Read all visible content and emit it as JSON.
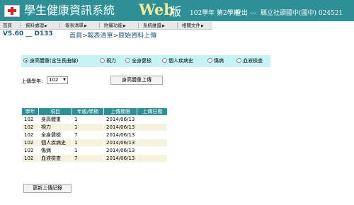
{
  "header": {
    "title": "學生健康資訊系統",
    "title_web": "Web",
    "title_suffix": "版",
    "term": "102學年 第2學期",
    "logout": "登出 ---",
    "school": "縣立社頭國中(國中) 024521"
  },
  "menu": {
    "items": [
      {
        "label": "首頁",
        "has_arrow": false
      },
      {
        "label": "資料處理",
        "has_arrow": true
      },
      {
        "label": "報表清單",
        "has_arrow": true
      },
      {
        "label": "附屬功能",
        "has_arrow": true
      },
      {
        "label": "系統維護",
        "has_arrow": true
      },
      {
        "label": "相關文件",
        "has_arrow": true
      }
    ]
  },
  "version": "V5.60 __ D133",
  "breadcrumb": "首頁>報表清單>原始資料上傳",
  "upload_types": {
    "selected": 0,
    "options": [
      "身高體重(含生長曲線)",
      "視力",
      "全身健檢",
      "個人疾病史",
      "傷病",
      "血液檢查"
    ]
  },
  "upload": {
    "year_label": "上傳學年:",
    "year_value": "102",
    "button_label": "身高體重上傳"
  },
  "table": {
    "headers": [
      "學年",
      "項目",
      "年級/學期",
      "上傳期限",
      "上傳日期"
    ],
    "rows": [
      [
        "102",
        "身高體重",
        "1",
        "2014/06/13",
        ""
      ],
      [
        "102",
        "視力",
        "1",
        "2014/06/13",
        ""
      ],
      [
        "102",
        "全身健檢",
        "7",
        "2014/06/13",
        ""
      ],
      [
        "102",
        "個人疾病史",
        "1",
        "2014/06/13",
        ""
      ],
      [
        "102",
        "傷病",
        "1",
        "2014/06/13",
        ""
      ],
      [
        "102",
        "血液檢查",
        "7",
        "2014/06/13",
        ""
      ]
    ]
  },
  "update_button": "更新上傳記錄",
  "colors": {
    "header_bg": "#2f8f96",
    "accent_title": "#f1e89a",
    "radio_bar_bg": "#c7f3f6",
    "row_alt_bg": "#f5f2dd"
  }
}
